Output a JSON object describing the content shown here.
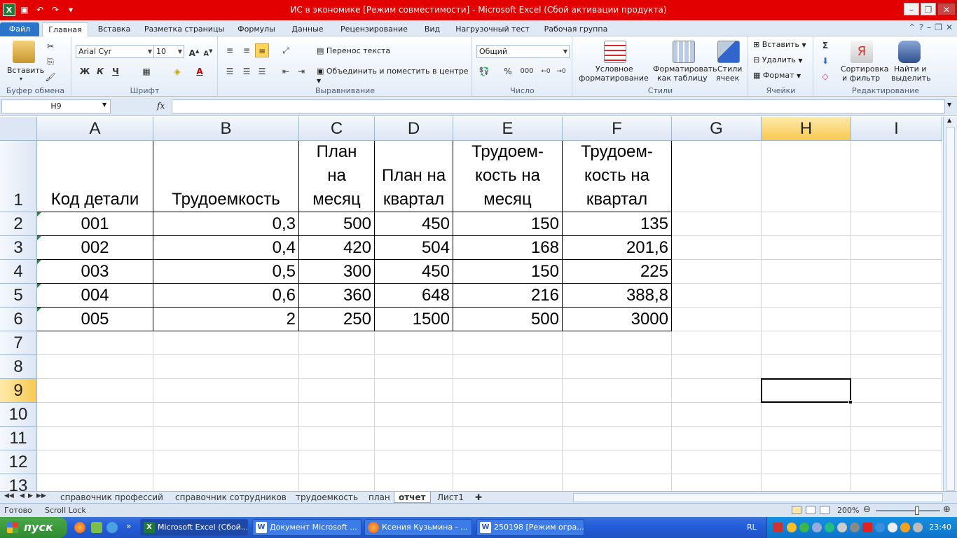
{
  "window": {
    "title": "ИС в экономике  [Режим совместимости]  -  Microsoft Excel (Сбой активации продукта)"
  },
  "ribbon_tabs": [
    "Файл",
    "Главная",
    "Вставка",
    "Разметка страницы",
    "Формулы",
    "Данные",
    "Рецензирование",
    "Вид",
    "Нагрузочный тест",
    "Рабочая группа"
  ],
  "ribbon": {
    "clipboard": {
      "paste": "Вставить",
      "label": "Буфер обмена"
    },
    "font": {
      "name": "Arial Cyr",
      "size": "10",
      "bold": "Ж",
      "italic": "К",
      "underline": "Ч",
      "label": "Шрифт"
    },
    "alignment": {
      "wrap": "Перенос текста",
      "merge": "Объединить и поместить в центре",
      "label": "Выравнивание"
    },
    "number": {
      "format": "Общий",
      "percent": "%",
      "thousands": "000",
      "label": "Число"
    },
    "styles": {
      "conditional": "Условное",
      "conditional2": "форматирование",
      "table": "Форматировать",
      "table2": "как таблицу",
      "cell": "Стили",
      "cell2": "ячеек",
      "label": "Стили"
    },
    "cells": {
      "insert": "Вставить",
      "delete": "Удалить",
      "format": "Формат",
      "label": "Ячейки"
    },
    "editing": {
      "sum": "Σ",
      "sort": "Сортировка",
      "sort2": "и фильтр",
      "find": "Найти и",
      "find2": "выделить",
      "label": "Редактирование"
    }
  },
  "formula_bar": {
    "name_box": "H9",
    "fx": "fx",
    "content": ""
  },
  "columns": [
    "A",
    "B",
    "C",
    "D",
    "E",
    "F",
    "G",
    "H",
    "I"
  ],
  "selected_column": "H",
  "rows": [
    "1",
    "2",
    "3",
    "4",
    "5",
    "6",
    "7",
    "8",
    "9",
    "10",
    "11",
    "12",
    "13"
  ],
  "selected_row": "9",
  "table": {
    "headers": [
      [
        "Код детали"
      ],
      [
        "Трудоемкость"
      ],
      [
        "План",
        "на",
        "месяц"
      ],
      [
        "План на",
        "квартал"
      ],
      [
        "Трудоем-",
        "кость на",
        "месяц"
      ],
      [
        "Трудоем-",
        "кость на",
        "квартал"
      ]
    ],
    "data": [
      [
        "001",
        "0,3",
        "500",
        "450",
        "150",
        "135"
      ],
      [
        "002",
        "0,4",
        "420",
        "504",
        "168",
        "201,6"
      ],
      [
        "003",
        "0,5",
        "300",
        "450",
        "150",
        "225"
      ],
      [
        "004",
        "0,6",
        "360",
        "648",
        "216",
        "388,8"
      ],
      [
        "005",
        "2",
        "250",
        "1500",
        "500",
        "3000"
      ]
    ]
  },
  "sheet_tabs": [
    "справочник профессий",
    "справочник сотрудников",
    "трудоемкость",
    "план",
    "отчет",
    "Лист1"
  ],
  "active_sheet": "отчет",
  "status": {
    "ready": "Готово",
    "scroll_lock": "Scroll Lock",
    "zoom": "200%"
  },
  "taskbar": {
    "start": "пуск",
    "items": [
      {
        "label": "Microsoft Excel (Сбой...",
        "active": true
      },
      {
        "label": "Документ Microsoft ...",
        "active": false
      },
      {
        "label": "Ксения Кузьмина - ...",
        "active": false
      },
      {
        "label": "250198 [Режим огра...",
        "active": false
      }
    ],
    "lang": "RL",
    "time": "23:40"
  },
  "colors": {
    "titlebar": "#e20000",
    "selection_header": "#f8c953",
    "file_tab": "#2a74c9",
    "taskbar": "#245edb"
  }
}
